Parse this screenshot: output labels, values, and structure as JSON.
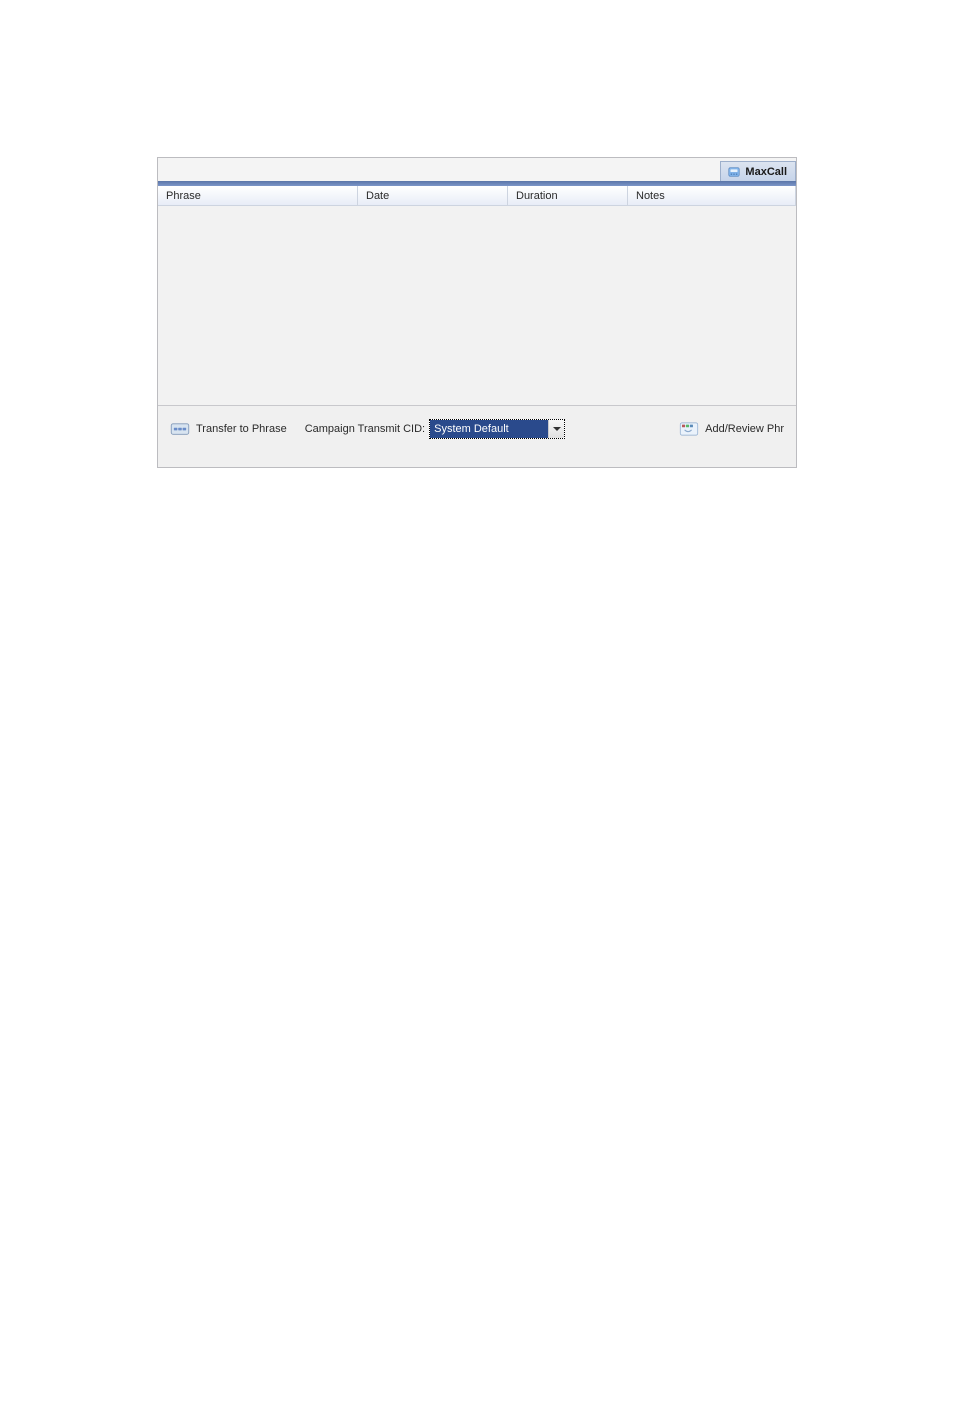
{
  "tab": {
    "label": "MaxCall"
  },
  "columns": {
    "phrase": "Phrase",
    "date": "Date",
    "duration": "Duration",
    "notes": "Notes"
  },
  "toolbar": {
    "transfer_label": "Transfer to Phrase",
    "cid_label": "Campaign Transmit CID:",
    "cid_value": "System Default",
    "addreview_label": "Add/Review Phr"
  }
}
